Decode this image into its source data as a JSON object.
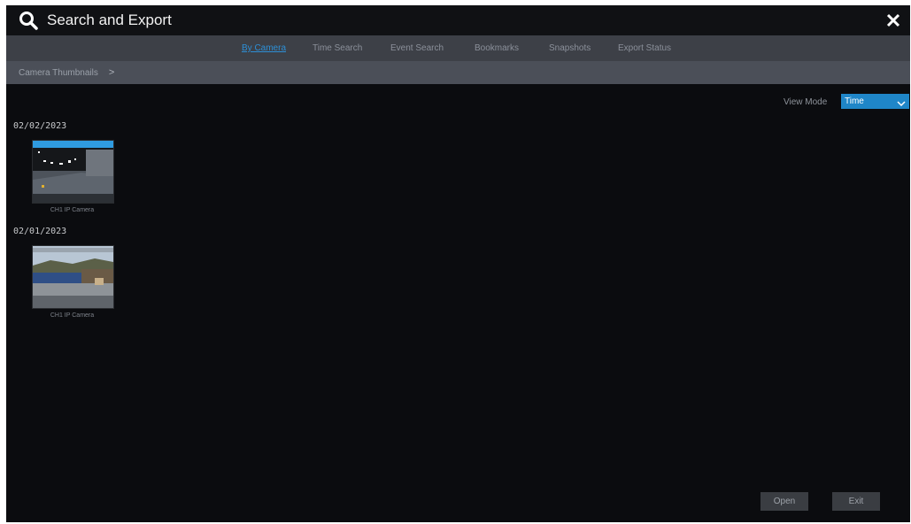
{
  "window": {
    "title": "Search and Export",
    "search_icon": "search-icon",
    "close_icon": "close-icon"
  },
  "tabs": [
    {
      "label": "By Camera",
      "active": true
    },
    {
      "label": "Time Search",
      "active": false
    },
    {
      "label": "Event Search",
      "active": false
    },
    {
      "label": "Bookmarks",
      "active": false
    },
    {
      "label": "Snapshots",
      "active": false
    },
    {
      "label": "Export Status",
      "active": false
    }
  ],
  "breadcrumb": {
    "label": "Camera Thumbnails",
    "chevron": ">"
  },
  "view_mode": {
    "label": "View Mode",
    "value": "Time"
  },
  "groups": [
    {
      "date": "02/02/2023",
      "caption": "CH1 IP Camera"
    },
    {
      "date": "02/01/2023",
      "caption": "CH1 IP Camera"
    }
  ],
  "buttons": {
    "open": "Open",
    "exit": "Exit"
  },
  "colors": {
    "accent": "#1f86c8",
    "background": "#0b0c0f",
    "tabbar": "#3d4047",
    "breadcrumb_bar": "#4b4f58"
  }
}
